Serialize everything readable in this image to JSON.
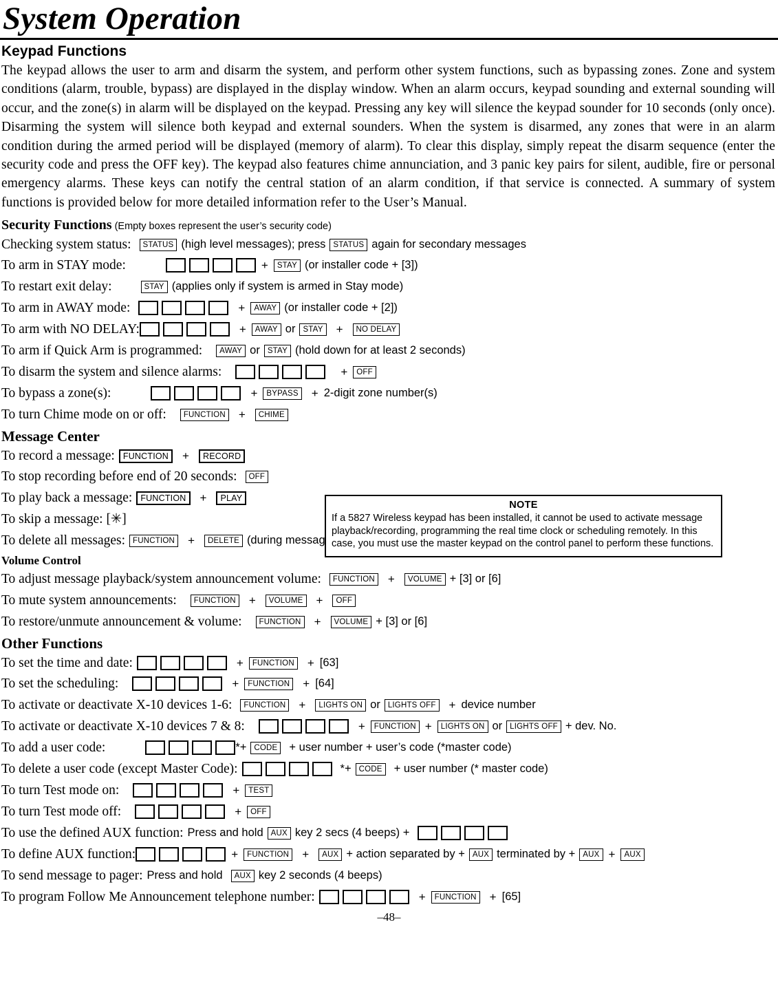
{
  "document": {
    "title": "System Operation",
    "page_number": "–48–"
  },
  "keypad_functions": {
    "heading": "Keypad Functions",
    "paragraph": "The keypad allows the user to arm and disarm the system, and perform other system functions, such as bypassing zones. Zone and system conditions (alarm, trouble, bypass) are displayed in the display window. When an alarm occurs, keypad sounding and external sounding will occur, and the zone(s) in alarm will be displayed on the keypad. Pressing any key will silence the keypad sounder for 10 seconds (only once). Disarming the system will silence both keypad and external sounders.  When the system is disarmed, any zones that were in an alarm condition during the armed period will be displayed (memory of alarm).  To clear this display, simply repeat the disarm sequence (enter the security code and press the OFF key). The keypad also features chime annunciation, and 3 panic key pairs for silent, audible, fire or personal emergency alarms.  These keys can notify the central station of an alarm condition, if that service is connected. A summary of system functions is provided below for more detailed information refer to the User’s Manual."
  },
  "security_functions": {
    "heading": "Security Functions",
    "heading_note": "(Empty boxes represent the user’s security code)",
    "rows": {
      "status": {
        "label": "Checking system status:",
        "key1": "STATUS",
        "mid": "(high level messages); press",
        "key2": "STATUS",
        "tail": "again for secondary messages"
      },
      "arm_stay": {
        "label": "To arm in STAY mode:",
        "plus": "+",
        "key": "STAY",
        "tail": "(or installer code + [3])"
      },
      "restart_exit": {
        "label": "To restart exit delay:",
        "key": "STAY",
        "tail": "(applies only if system is armed in Stay mode)"
      },
      "arm_away": {
        "label": "To arm in AWAY mode:",
        "plus": "+",
        "key": "AWAY",
        "tail": "(or installer code + [2])"
      },
      "arm_no_delay": {
        "label": "To arm with NO DELAY:",
        "plus1": "+",
        "key1": "AWAY",
        "or": "or",
        "key2": "STAY",
        "plus2": "+",
        "key3": "NO DELAY"
      },
      "quick_arm": {
        "label": "To arm if Quick Arm is programmed:",
        "key1": "AWAY",
        "or": "or",
        "key2": "STAY",
        "tail": "(hold down for at least 2 seconds)"
      },
      "disarm": {
        "label": "To disarm the system and silence alarms:",
        "plus": "+",
        "key": "OFF"
      },
      "bypass": {
        "label": "To bypass a zone(s):",
        "plus1": "+",
        "key": "BYPASS",
        "plus2": "+",
        "tail": "2-digit zone number(s)"
      },
      "chime": {
        "label": "To turn Chime mode on or off:",
        "key1": "FUNCTION",
        "plus": "+",
        "key2": "CHIME"
      }
    }
  },
  "message_center": {
    "heading": "Message Center",
    "rows": {
      "record": {
        "label": "To record a message:",
        "key1": "FUNCTION",
        "plus": "+",
        "key2": "RECORD"
      },
      "stop": {
        "label": "To stop recording before end of 20 seconds:",
        "key": "OFF"
      },
      "play": {
        "label": "To play back a message:",
        "key1": "FUNCTION",
        "plus": "+",
        "key2": "PLAY"
      },
      "skip": {
        "label": "To skip a message: [✳]"
      },
      "delete_all": {
        "label": "To delete all messages:",
        "key1": "FUNCTION",
        "plus": "+",
        "key2": "DELETE",
        "tail": "(during message replay)"
      }
    }
  },
  "note": {
    "title": "NOTE",
    "body": "If a 5827 Wireless keypad has been installed, it cannot be used to activate message playback/recording, programming the real time clock or scheduling remotely. In this case, you must use the master keypad on the control panel to perform these functions."
  },
  "volume_control": {
    "heading": "Volume Control",
    "rows": {
      "adjust": {
        "label": "To adjust message playback/system announcement volume:",
        "key1": "FUNCTION",
        "plus1": "+",
        "key2": "VOLUME",
        "tail": "+ [3]  or [6]"
      },
      "mute": {
        "label": "To mute system announcements:",
        "key1": "FUNCTION",
        "plus1": "+",
        "key2": "VOLUME",
        "plus2": "+",
        "key3": "OFF"
      },
      "restore": {
        "label": "To restore/unmute announcement & volume:",
        "key1": "FUNCTION",
        "plus1": "+",
        "key2": "VOLUME",
        "tail": "+ [3]  or [6]"
      }
    }
  },
  "other_functions": {
    "heading": "Other Functions",
    "rows": {
      "time_date": {
        "label": "To set the time and date:",
        "plus1": "+",
        "key": "FUNCTION",
        "plus2": "+",
        "tail": "[63]"
      },
      "scheduling": {
        "label": "To set the scheduling:",
        "plus1": "+",
        "key": "FUNCTION",
        "plus2": "+",
        "tail": "[64]"
      },
      "x10_1_6": {
        "label": "To activate or deactivate X-10 devices 1-6:",
        "key1": "FUNCTION",
        "plus1": "+",
        "key2": "LIGHTS ON",
        "or": "or",
        "key3": "LIGHTS OFF",
        "plus2": "+",
        "tail": "device number"
      },
      "x10_7_8": {
        "label": "To activate or deactivate X-10 devices 7 & 8:",
        "plus1": "+",
        "key1": "FUNCTION",
        "plus2": "+",
        "key2": "LIGHTS ON",
        "or": "or",
        "key3": "LIGHTS OFF",
        "tail": "+ dev. No."
      },
      "add_user": {
        "label": "To add a user code:",
        "star_plus": "*+",
        "key": "CODE",
        "tail": "+ user number + user’s code (*master code)"
      },
      "delete_user": {
        "label": "To delete a user code (except Master Code):",
        "star_plus": "*+",
        "key": "CODE",
        "tail": "+ user number (* master code)"
      },
      "test_on": {
        "label": "To turn Test mode on:",
        "plus": "+",
        "key": "TEST"
      },
      "test_off": {
        "label": "To turn Test mode off:",
        "plus": "+",
        "key": "OFF"
      },
      "use_aux": {
        "label": "To use the defined AUX function:",
        "pre": "Press and hold",
        "key": "AUX",
        "mid": "key 2 secs (4 beeps) +"
      },
      "define_aux": {
        "label": "To define AUX function:",
        "plus1": "+",
        "key1": "FUNCTION",
        "plus2": "+",
        "key2": "AUX",
        "mid1": "+ action separated by +",
        "key3": "AUX",
        "mid2": "terminated by +",
        "key4": "AUX",
        "plus3": "+",
        "key5": "AUX"
      },
      "pager": {
        "label": "To send message to pager:",
        "pre": "Press and hold",
        "key": "AUX",
        "tail": "key 2 seconds (4 beeps)"
      },
      "follow_me": {
        "label": "To program Follow Me Announcement telephone number:",
        "plus1": "+",
        "key": "FUNCTION",
        "plus2": "+",
        "tail": "[65]"
      }
    }
  }
}
